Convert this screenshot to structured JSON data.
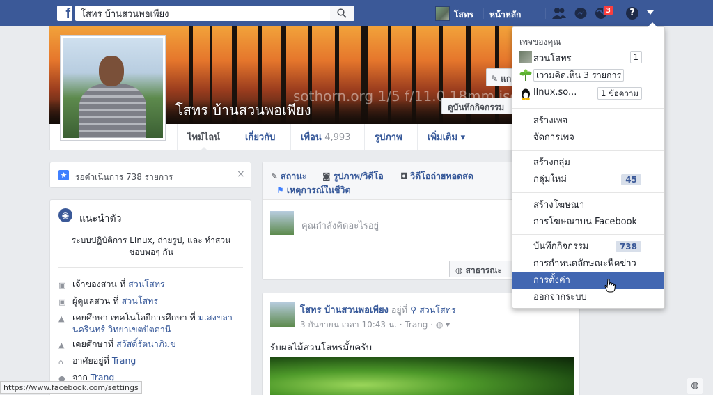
{
  "topbar": {
    "logo": "f",
    "search_value": "โสทร บ้านสวนพอเพียง",
    "user_name": "โสทร",
    "home_label": "หน้าหลัก",
    "notification_count": "3",
    "help_symbol": "?"
  },
  "profile": {
    "cover_watermark": "sothorn.org   1/5 f/11.0 18mm iso 100",
    "name": "โสทร บ้านสวนพอเพียง",
    "edit_cover_label": "แก",
    "activity_log_label": "ดูบันทึกกิจกรรม"
  },
  "tabs": [
    {
      "label": "ไทม์ไลน์"
    },
    {
      "label": "เกี่ยวกับ"
    },
    {
      "label": "เพื่อน",
      "count": "4,993"
    },
    {
      "label": "รูปภาพ"
    },
    {
      "label": "เพิ่มเติม ▾"
    }
  ],
  "pending": {
    "text": "รอดำเนินการ 738 รายการ",
    "close": "×"
  },
  "intro": {
    "title": "แนะนำตัว",
    "bio": "ระบบปฏิบัติการ LInux, ถ่ายรูป, และ ทำสวน ชอบพอๆ กัน",
    "rows": [
      {
        "prefix": "เจ้าของสวน ที่ ",
        "link": "สวนโสทร"
      },
      {
        "prefix": "ผู้ดูแลสวน ที่ ",
        "link": "สวนโสทร"
      },
      {
        "prefix": "เคยศึกษา เทคโนโลยีการศึกษา ที่ ",
        "link": "ม.สงขลานครินทร์ วิทยาเขตปัตตานี"
      },
      {
        "prefix": "เคยศึกษาที่ ",
        "link": "สวัสดิ์รัตนาภิมข"
      },
      {
        "prefix": "อาศัยอยู่ที่ ",
        "link": "Trang"
      },
      {
        "prefix": "จาก ",
        "link": "Trang"
      }
    ]
  },
  "composer": {
    "tab_status": "สถานะ",
    "tab_photo": "รูปภาพ/วิดีโอ",
    "tab_live": "วิดีโอถ่ายทอดสด",
    "tab_life_event": "เหตุการณ์ในชีวิต",
    "placeholder": "คุณกำลังคิดอะไรอยู่",
    "privacy_label": "สาธารณะ"
  },
  "post": {
    "author": "โสทร บ้านสวนพอเพียง",
    "at_text": " อยู่ที่ ",
    "place": "สวนโสทร",
    "date": "3 กันยายน เวลา 10:43 น. · Trang ·",
    "text": "รับผลไม้สวนโสทรมั้ยครับ"
  },
  "dropdown": {
    "your_pages_title": "เพจของคุณ",
    "pages": [
      {
        "name": "สวนโสทร",
        "count": "1"
      },
      {
        "name": "เวามคิดเห็น 3 รายการ",
        "count": ""
      },
      {
        "name": "llnux.so...",
        "count": "1 ข้อความ"
      }
    ],
    "create_page": "สร้างเพจ",
    "manage_pages": "จัดการเพจ",
    "create_group": "สร้างกลุ่ม",
    "new_groups": "กลุ่มใหม่",
    "new_groups_count": "45",
    "create_ad": "สร้างโฆษณา",
    "ads_on_facebook": "การโฆษณาบน Facebook",
    "activity_log": "บันทึกกิจกรรม",
    "activity_log_count": "738",
    "news_feed_prefs": "การกำหนดลักษณะฟีดข่าว",
    "settings": "การตั้งค่า",
    "log_out": "ออกจากระบบ"
  },
  "status_url": "https://www.facebook.com/settings",
  "colors": {
    "brand": "#3b5998",
    "link": "#365899",
    "highlight": "#4267b2",
    "badge": "#fa3e3e"
  }
}
